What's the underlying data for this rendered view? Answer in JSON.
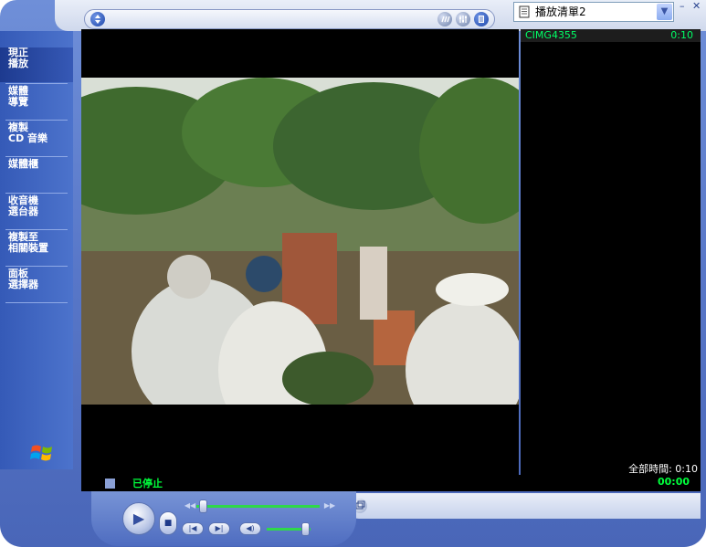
{
  "nav": {
    "items": [
      {
        "label": "現正\n播放"
      },
      {
        "label": "媒體\n導覽"
      },
      {
        "label": "複製\nCD 音樂"
      },
      {
        "label": "媒體櫃"
      },
      {
        "label": "收音機\n選台器"
      },
      {
        "label": "複製至\n相關裝置"
      },
      {
        "label": "面板\n選擇器"
      }
    ]
  },
  "playlist": {
    "selected": "播放清單2",
    "items": [
      {
        "title": "CIMG4355",
        "duration": "0:10"
      }
    ],
    "total_time": "全部時間: 0:10"
  },
  "status": {
    "text": "已停止",
    "time": "00:00"
  },
  "player": {
    "seek_fraction": 0.02,
    "volume_fraction": 0.85
  },
  "icons": {
    "play": "play-icon",
    "stop": "stop-icon",
    "previous": "previous-icon",
    "next": "next-icon",
    "mute": "speaker-icon"
  },
  "colors": {
    "status_green": "#00ff3c",
    "frame_blue": "#5877c8"
  }
}
